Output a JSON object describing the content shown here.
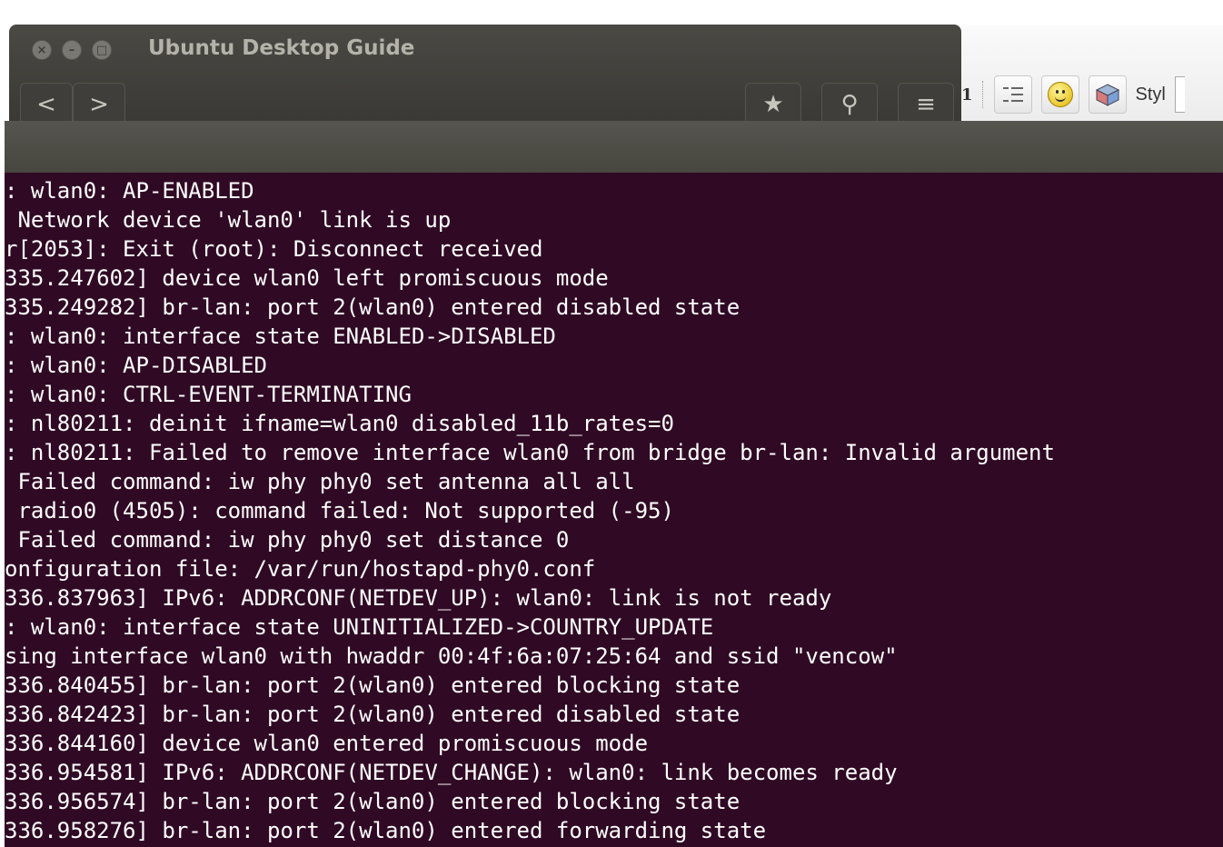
{
  "background_app": {
    "toolbar": {
      "page_number": "1",
      "style_label": "Styl"
    }
  },
  "window": {
    "title": "Ubuntu Desktop Guide",
    "buttons": {
      "close": "×",
      "minimize": "–",
      "maximize": "□"
    },
    "nav": {
      "back": "<",
      "forward": ">"
    },
    "actions": {
      "bookmark": "★",
      "search": "⚲",
      "menu": "≡"
    }
  },
  "terminal": {
    "colors": {
      "background": "#300a24",
      "text": "#ffffff"
    },
    "lines": [
      ": wlan0: AP-ENABLED",
      " Network device 'wlan0' link is up",
      "r[2053]: Exit (root): Disconnect received",
      "335.247602] device wlan0 left promiscuous mode",
      "335.249282] br-lan: port 2(wlan0) entered disabled state",
      ": wlan0: interface state ENABLED->DISABLED",
      ": wlan0: AP-DISABLED",
      ": wlan0: CTRL-EVENT-TERMINATING",
      ": nl80211: deinit ifname=wlan0 disabled_11b_rates=0",
      ": nl80211: Failed to remove interface wlan0 from bridge br-lan: Invalid argument",
      " Failed command: iw phy phy0 set antenna all all",
      " radio0 (4505): command failed: Not supported (-95)",
      " Failed command: iw phy phy0 set distance 0",
      "onfiguration file: /var/run/hostapd-phy0.conf",
      "336.837963] IPv6: ADDRCONF(NETDEV_UP): wlan0: link is not ready",
      ": wlan0: interface state UNINITIALIZED->COUNTRY_UPDATE",
      "sing interface wlan0 with hwaddr 00:4f:6a:07:25:64 and ssid \"vencow\"",
      "336.840455] br-lan: port 2(wlan0) entered blocking state",
      "336.842423] br-lan: port 2(wlan0) entered disabled state",
      "336.844160] device wlan0 entered promiscuous mode",
      "336.954581] IPv6: ADDRCONF(NETDEV_CHANGE): wlan0: link becomes ready",
      "336.956574] br-lan: port 2(wlan0) entered blocking state",
      "336.958276] br-lan: port 2(wlan0) entered forwarding state"
    ]
  }
}
